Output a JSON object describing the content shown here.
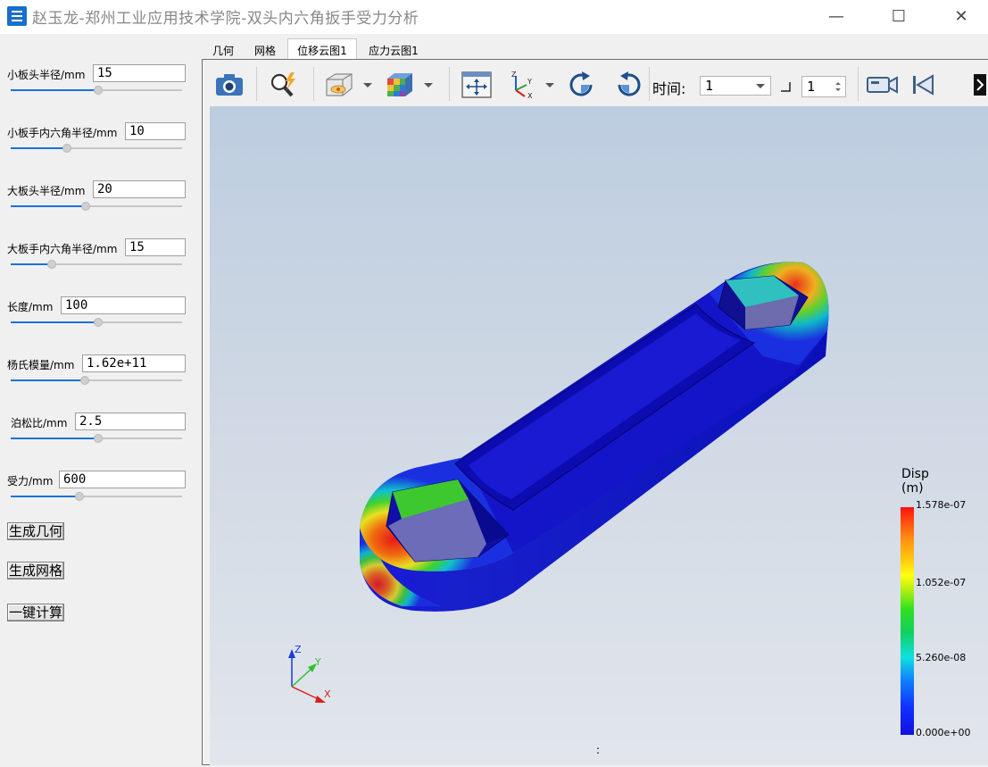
{
  "window": {
    "title": "赵玉龙-郑州工业应用技术学院-双头内六角扳手受力分析",
    "minimize_glyph": "—",
    "maximize_glyph": "☐",
    "close_glyph": "✕"
  },
  "params": [
    {
      "label": "小板头半径/mm",
      "value": "15",
      "slider_fraction": 0.51
    },
    {
      "label": "小板手内六角半径/mm",
      "value": "10",
      "slider_fraction": 0.33
    },
    {
      "label": "大板头半径/mm",
      "value": "20",
      "slider_fraction": 0.44
    },
    {
      "label": "大板手内六角半径/mm",
      "value": "15",
      "slider_fraction": 0.24
    },
    {
      "label": "长度/mm",
      "value": "100",
      "slider_fraction": 0.51
    },
    {
      "label": "杨氏模量/mm",
      "value": "1.62e+11",
      "slider_fraction": 0.43
    },
    {
      "label": "泊松比/mm",
      "value": "2.5",
      "slider_fraction": 0.51
    },
    {
      "label": "受力/mm",
      "value": "600",
      "slider_fraction": 0.4
    }
  ],
  "buttons": {
    "gen_geometry": "生成几何",
    "gen_mesh": "生成网格",
    "one_click_calc": "一键计算"
  },
  "tabs": [
    {
      "label": "几何",
      "active": false
    },
    {
      "label": "网格",
      "active": false
    },
    {
      "label": "位移云图1",
      "active": true
    },
    {
      "label": "应力云图1",
      "active": false
    }
  ],
  "toolbar": {
    "time_label": "时间:",
    "time_value": "1",
    "step_value": "1"
  },
  "legend": {
    "title_line1": "Disp",
    "title_line2": "(m)",
    "max": "1.578e-07",
    "mid_high": "1.052e-07",
    "mid_low": "5.260e-08",
    "min": "0.000e+00"
  },
  "axes": {
    "z": "Z",
    "y": "Y",
    "x": "X"
  },
  "colors": {
    "accent": "#1a73d9",
    "legend_max": "#ff1010",
    "legend_min": "#1010e0"
  },
  "status_text": ":"
}
